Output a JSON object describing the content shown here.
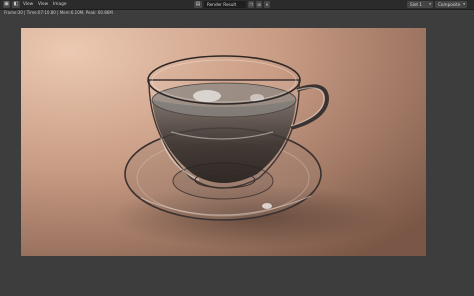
{
  "header": {
    "editor_icon": "image-editor-icon",
    "menus": [
      "View",
      "View",
      "Image"
    ],
    "image_name": "Render Result",
    "slot": "Slot 1",
    "layer": "Composite"
  },
  "status": {
    "text": "Frame:30 | Time:07:10.80 | Mem:6.10M, Peak: 60.86M"
  }
}
